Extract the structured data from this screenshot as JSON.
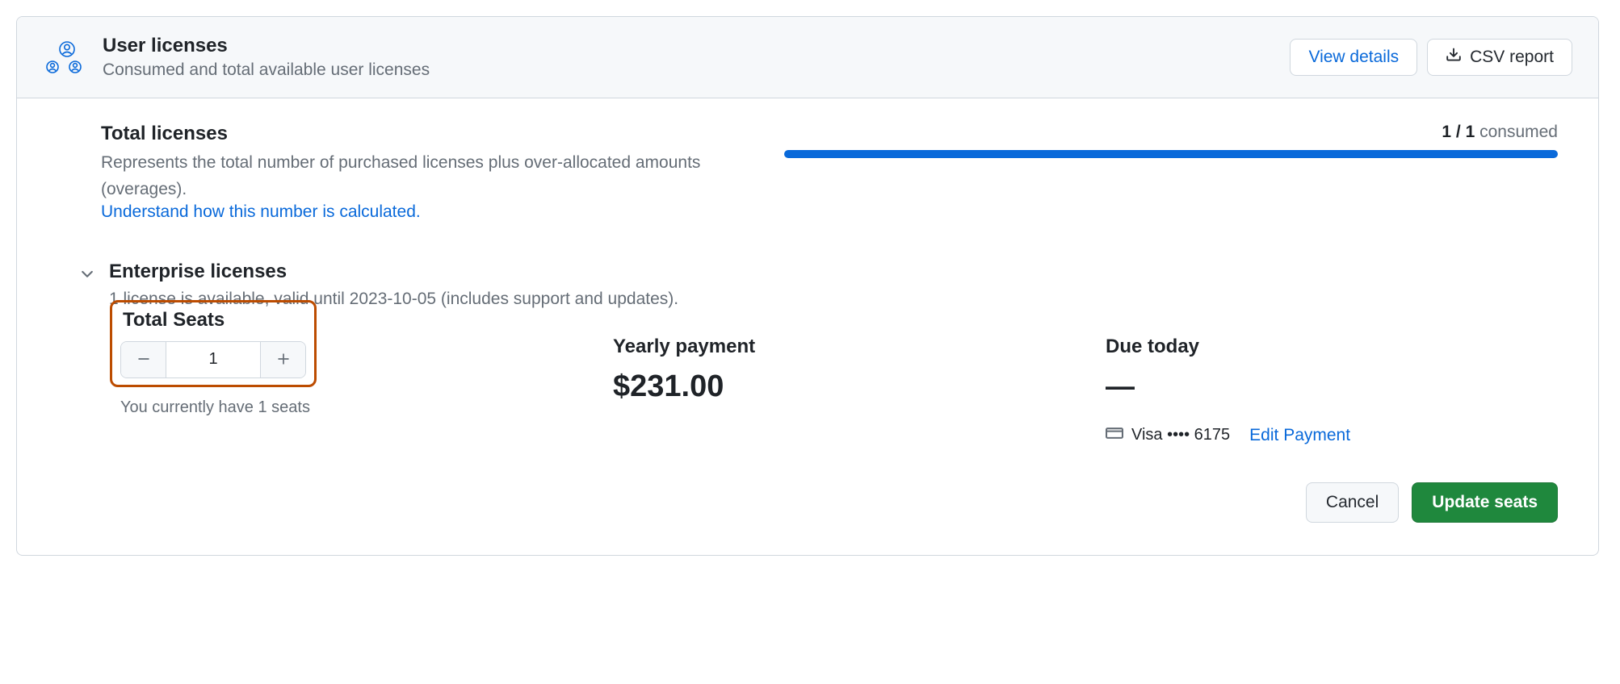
{
  "header": {
    "title": "User licenses",
    "subtitle": "Consumed and total available user licenses",
    "view_details": "View details",
    "csv_report": "CSV report"
  },
  "total_licenses": {
    "title": "Total licenses",
    "desc": "Represents the total number of purchased licenses plus over-allocated amounts (overages).",
    "link": "Understand how this number is calculated.",
    "consumed_prefix": "1 / 1",
    "consumed_suffix": " consumed"
  },
  "enterprise": {
    "title": "Enterprise licenses",
    "desc": "1 license is available, valid until 2023-10-05 (includes support and updates)."
  },
  "seats": {
    "title": "Total Seats",
    "value": "1",
    "note": "You currently have 1 seats"
  },
  "yearly": {
    "title": "Yearly payment",
    "amount": "$231.00"
  },
  "due": {
    "title": "Due today",
    "amount": "—",
    "card": "Visa •••• 6175",
    "edit": "Edit Payment"
  },
  "footer": {
    "cancel": "Cancel",
    "update": "Update seats"
  }
}
